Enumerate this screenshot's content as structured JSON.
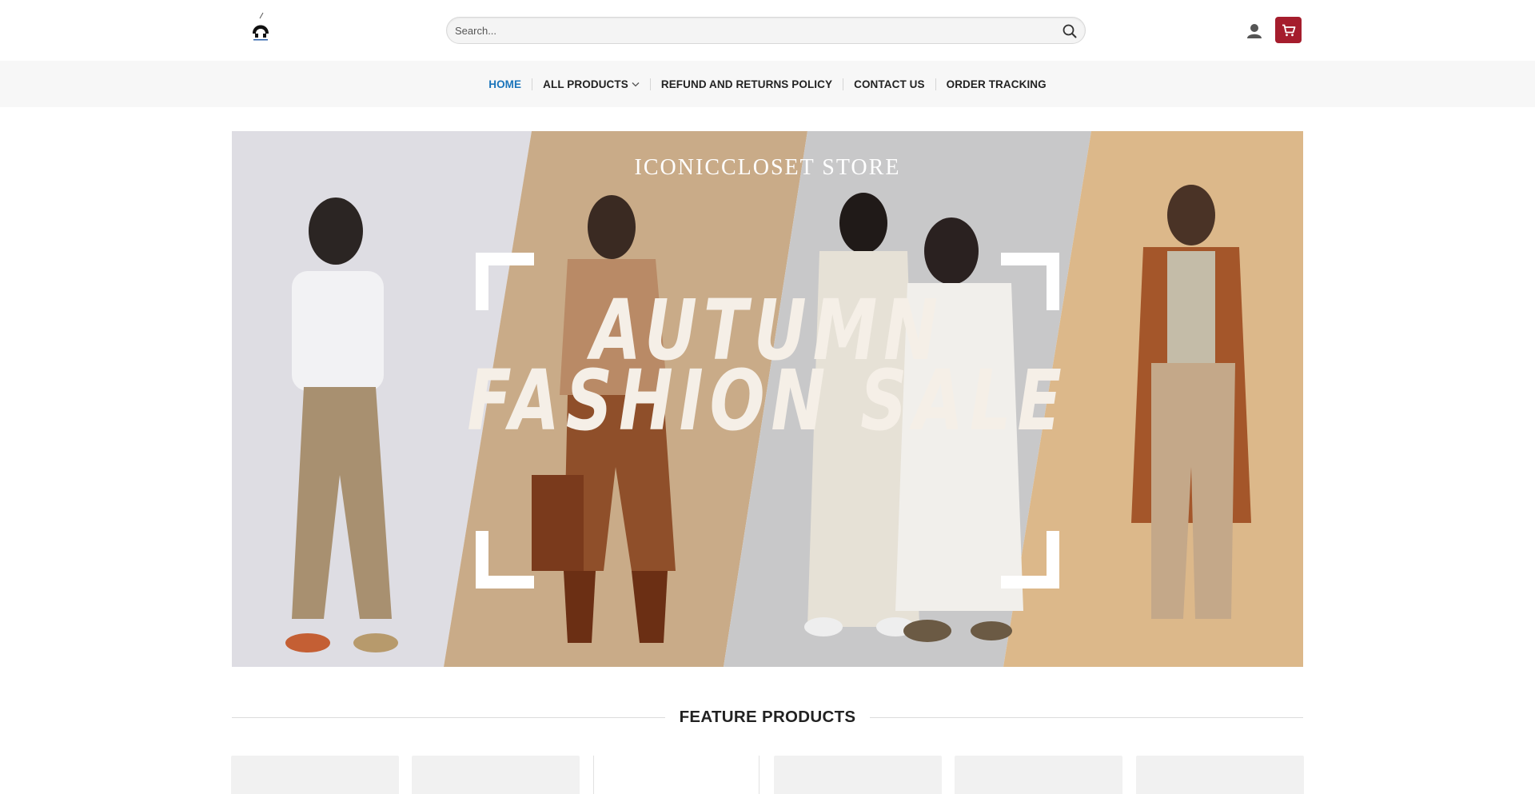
{
  "header": {
    "search_placeholder": "Search...",
    "cart_color": "#a51d2d"
  },
  "nav": {
    "items": [
      {
        "label": "HOME",
        "active": true
      },
      {
        "label": "ALL PRODUCTS",
        "has_dropdown": true
      },
      {
        "label": "REFUND AND RETURNS POLICY"
      },
      {
        "label": "CONTACT US"
      },
      {
        "label": "ORDER TRACKING"
      }
    ],
    "active_color": "#1b75bb"
  },
  "hero": {
    "store_name": "ICONICCLOSET STORE",
    "title_line1": "AUTUMN",
    "title_line2": "FASHION SALE"
  },
  "featured": {
    "title": "FEATURE PRODUCTS"
  }
}
